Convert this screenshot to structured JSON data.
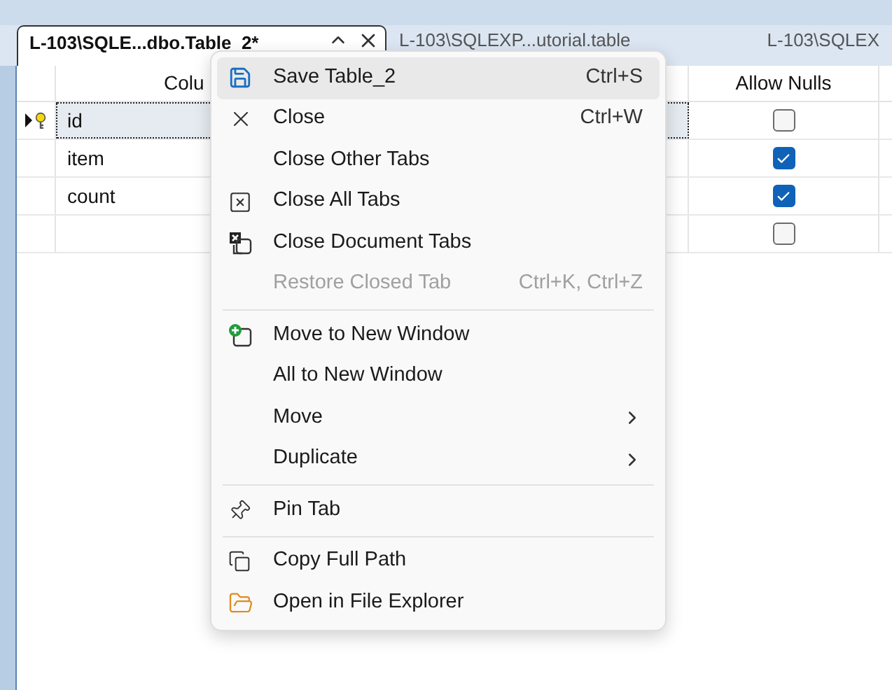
{
  "tabs": [
    {
      "label": "L-103\\SQLE...dbo.Table_2*",
      "selected": true
    },
    {
      "label": "L-103\\SQLEXP...utorial.table",
      "selected": false
    },
    {
      "label": "L-103\\SQLEX",
      "selected": false
    }
  ],
  "grid": {
    "columns": [
      "Colu",
      "Allow Nulls"
    ],
    "rows": [
      {
        "name": "id",
        "primary_key": true,
        "selected": true,
        "allow_nulls": false
      },
      {
        "name": "item",
        "primary_key": false,
        "selected": false,
        "allow_nulls": true
      },
      {
        "name": "count",
        "primary_key": false,
        "selected": false,
        "allow_nulls": true
      },
      {
        "primary_key": false,
        "selected": false,
        "allow_nulls": false
      }
    ]
  },
  "menu": [
    {
      "kind": "item",
      "label": "Save Table_2",
      "shortcut": "Ctrl+S",
      "selected": true,
      "disabled": false
    },
    {
      "kind": "item",
      "label": "Close",
      "shortcut": "Ctrl+W",
      "selected": false,
      "disabled": false
    },
    {
      "kind": "item",
      "label": "Close Other Tabs",
      "selected": false,
      "disabled": false
    },
    {
      "kind": "item",
      "label": "Close All Tabs",
      "selected": false,
      "disabled": false
    },
    {
      "kind": "item",
      "label": "Close Document Tabs",
      "selected": false,
      "disabled": false
    },
    {
      "kind": "item",
      "label": "Restore Closed Tab",
      "shortcut": "Ctrl+K, Ctrl+Z",
      "selected": false,
      "disabled": true
    },
    {
      "kind": "separator"
    },
    {
      "kind": "item",
      "label": "Move to New Window",
      "selected": false,
      "disabled": false
    },
    {
      "kind": "item",
      "label": "All to New Window",
      "selected": false,
      "disabled": false
    },
    {
      "kind": "submenu",
      "label": "Move",
      "selected": false,
      "disabled": false
    },
    {
      "kind": "submenu",
      "label": "Duplicate",
      "selected": false,
      "disabled": false
    },
    {
      "kind": "separator"
    },
    {
      "kind": "item",
      "label": "Pin Tab",
      "selected": false,
      "disabled": false
    },
    {
      "kind": "separator"
    },
    {
      "kind": "item",
      "label": "Copy Full Path",
      "selected": false,
      "disabled": false
    },
    {
      "kind": "item",
      "label": "Open in File Explorer",
      "selected": false,
      "disabled": false
    }
  ]
}
